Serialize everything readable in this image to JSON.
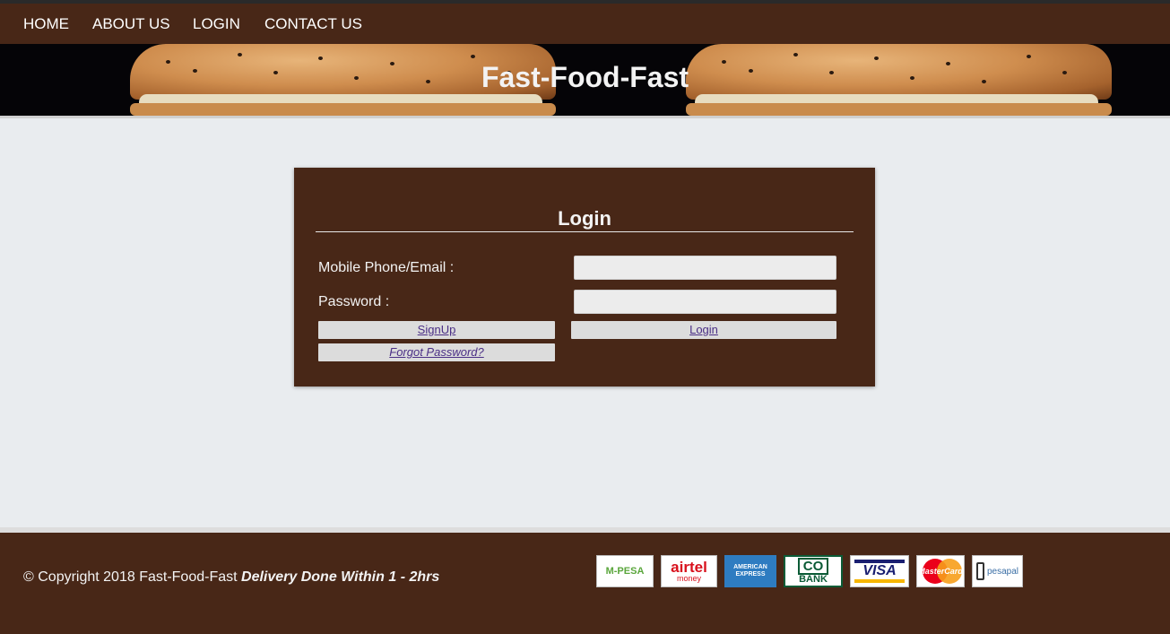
{
  "nav": {
    "items": [
      {
        "label": "HOME"
      },
      {
        "label": "ABOUT US"
      },
      {
        "label": "LOGIN"
      },
      {
        "label": "CONTACT US"
      }
    ]
  },
  "banner": {
    "title": "Fast-Food-Fast"
  },
  "login": {
    "heading": "Login",
    "identity_label": "Mobile Phone/Email :",
    "identity_value": "",
    "password_label": "Password :",
    "password_value": "",
    "signup_label": "SignUp",
    "login_label": "Login",
    "forgot_label": "Forgot Password?"
  },
  "footer": {
    "copyright": "© Copyright 2018 Fast-Food-Fast",
    "tagline": "Delivery Done Within 1 - 2hrs",
    "payment_logos": [
      {
        "text": "M-PESA",
        "icon": "mpesa-logo"
      },
      {
        "text": "airtel",
        "sub": "money",
        "icon": "airtel-money-logo"
      },
      {
        "text": "AMERICAN EXPRESS",
        "icon": "american-express-logo"
      },
      {
        "text": "CO",
        "sub": "BANK",
        "icon": "co-op-bank-logo"
      },
      {
        "text": "VISA",
        "icon": "visa-logo"
      },
      {
        "text": "MasterCard",
        "icon": "mastercard-logo"
      },
      {
        "text": "pesapal",
        "icon": "pesapal-logo"
      }
    ]
  },
  "colors": {
    "brand_brown": "#482717",
    "page_bg": "#e9ecef",
    "link_purple": "#4b2f86"
  }
}
